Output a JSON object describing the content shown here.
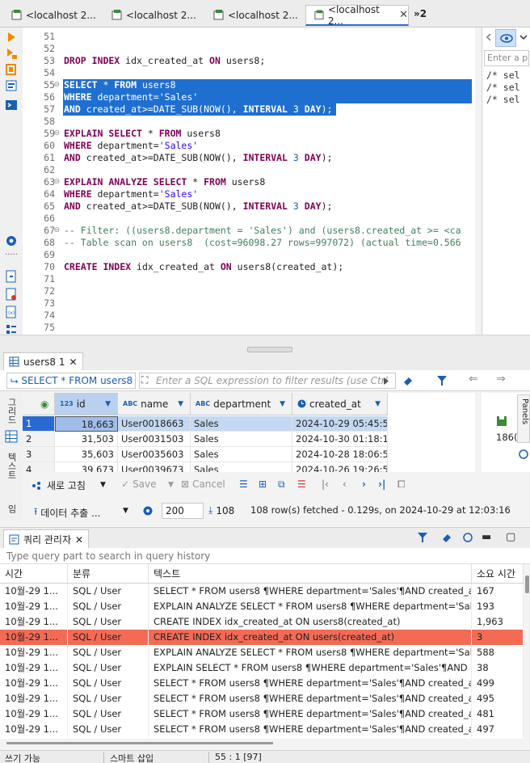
{
  "tabs": [
    {
      "label": "<localhost 2...",
      "active": false
    },
    {
      "label": "<localhost 2...",
      "active": false
    },
    {
      "label": "<localhost 2...",
      "active": false
    },
    {
      "label": "<localhost 2...",
      "active": true
    }
  ],
  "tabs_overflow": "»2",
  "editor": {
    "lines": [
      {
        "n": "51",
        "html": ""
      },
      {
        "n": "52",
        "html": ""
      },
      {
        "n": "53",
        "html": "<span class='kw'>DROP INDEX</span> idx_created_at <span class='kw'>ON</span> users8;"
      },
      {
        "n": "54",
        "html": ""
      },
      {
        "n": "55",
        "html": "<span class='kw'>SELECT</span> * <span class='kw'>FROM</span> users8",
        "sel": true,
        "fold": true
      },
      {
        "n": "56",
        "html": "<span class='kw'>WHERE</span> department=<span class='str'>'Sales'</span>",
        "sel": true
      },
      {
        "n": "57",
        "html": "<span class='kw'>AND</span> created_at&gt;=DATE_SUB(NOW(), <span class='kw'>INTERVAL</span> <span class='num'>3</span> <span class='kw'>DAY</span>);",
        "sel": true,
        "selw": 338
      },
      {
        "n": "58",
        "html": ""
      },
      {
        "n": "59",
        "html": "<span class='kw'>EXPLAIN SELECT</span> * <span class='kw'>FROM</span> users8",
        "fold": true
      },
      {
        "n": "60",
        "html": "<span class='kw'>WHERE</span> department=<span class='str'>'Sales'</span>"
      },
      {
        "n": "61",
        "html": "<span class='kw'>AND</span> created_at&gt;=DATE_SUB(NOW(), <span class='kw'>INTERVAL</span> <span class='num'>3</span> <span class='kw'>DAY</span>);"
      },
      {
        "n": "62",
        "html": ""
      },
      {
        "n": "63",
        "html": "<span class='kw'>EXPLAIN ANALYZE SELECT</span> * <span class='kw'>FROM</span> users8",
        "fold": true
      },
      {
        "n": "64",
        "html": "<span class='kw'>WHERE</span> department=<span class='str'>'Sales'</span>"
      },
      {
        "n": "65",
        "html": "<span class='kw'>AND</span> created_at&gt;=DATE_SUB(NOW(), <span class='kw'>INTERVAL</span> <span class='num'>3</span> <span class='kw'>DAY</span>);"
      },
      {
        "n": "66",
        "html": ""
      },
      {
        "n": "67",
        "html": "<span class='cmt'>-- Filter: ((users8.department = 'Sales') and (users8.created_at &gt;= &lt;ca</span>",
        "fold": true
      },
      {
        "n": "68",
        "html": "<span class='cmt'>-- Table scan on users8  (cost=96098.27 rows=997072) (actual time=0.566</span>"
      },
      {
        "n": "69",
        "html": ""
      },
      {
        "n": "70",
        "html": "<span class='kw'>CREATE INDEX</span> idx_created_at <span class='kw'>ON</span> users8(created_at);"
      },
      {
        "n": "71",
        "html": ""
      },
      {
        "n": "72",
        "html": ""
      },
      {
        "n": "73",
        "html": ""
      },
      {
        "n": "74",
        "html": ""
      },
      {
        "n": "75",
        "html": ""
      }
    ]
  },
  "outline": {
    "filter_placeholder": "Enter a pa",
    "lines": [
      "/* sel",
      "/* sel",
      "/* sel"
    ]
  },
  "results_tab": {
    "label": "users8 1"
  },
  "filter_bar": {
    "sql": "SELECT * FROM users8 W",
    "placeholder": "Enter a SQL expression to filter results (use Ctrl"
  },
  "grid_side": {
    "text_label": "텍스트",
    "grid_label": "그리드",
    "bottom_label": "임"
  },
  "grid": {
    "columns": [
      {
        "type": "123",
        "name": "id"
      },
      {
        "type": "ABC",
        "name": "name"
      },
      {
        "type": "ABC",
        "name": "department"
      },
      {
        "type": "clock",
        "name": "created_at"
      }
    ],
    "rows": [
      {
        "num": "1",
        "id": "18,663",
        "name": "User0018663",
        "department": "Sales",
        "created_at": "2024-10-29 05:45:51",
        "selected": true
      },
      {
        "num": "2",
        "id": "31,503",
        "name": "User0031503",
        "department": "Sales",
        "created_at": "2024-10-30 01:18:16"
      },
      {
        "num": "3",
        "id": "35,603",
        "name": "User0035603",
        "department": "Sales",
        "created_at": "2024-10-28 18:06:53"
      },
      {
        "num": "4",
        "id": "39,673",
        "name": "User0039673",
        "department": "Sales",
        "created_at": "2024-10-26 19:26:58"
      }
    ],
    "right_panel_label": "Panels",
    "right_value": "186("
  },
  "toolbar1": {
    "refresh": "새로 고침",
    "save": "Save",
    "cancel": "Cancel"
  },
  "toolbar2": {
    "export": "데이터 추출 ...",
    "limit": "200",
    "fetch_count": "108",
    "status": "108 row(s) fetched - 0.129s, on 2024-10-29 at 12:03:16"
  },
  "query_manager": {
    "tab_label": "쿼리 관리자",
    "search_placeholder": "Type query part to search in query history",
    "headers": {
      "time": "시간",
      "category": "분류",
      "text": "텍스트",
      "duration": "소요 시간"
    },
    "rows": [
      {
        "time": "10월-29 1...",
        "category": "SQL / User",
        "text": "SELECT * FROM users8 ¶WHERE department='Sales'¶AND created_at>...",
        "duration": "167"
      },
      {
        "time": "10월-29 1...",
        "category": "SQL / User",
        "text": "EXPLAIN ANALYZE SELECT * FROM users8 ¶WHERE department='Sale...",
        "duration": "193"
      },
      {
        "time": "10월-29 1...",
        "category": "SQL / User",
        "text": "CREATE INDEX idx_created_at ON users8(created_at)",
        "duration": "1,963"
      },
      {
        "time": "10월-29 1...",
        "category": "SQL / User",
        "text": "CREATE INDEX idx_created_at ON users(created_at)",
        "duration": "3",
        "highlight": true
      },
      {
        "time": "10월-29 1...",
        "category": "SQL / User",
        "text": "EXPLAIN ANALYZE SELECT * FROM users8 ¶WHERE department='Sale...",
        "duration": "588"
      },
      {
        "time": "10월-29 1...",
        "category": "SQL / User",
        "text": "EXPLAIN SELECT * FROM users8 ¶WHERE department='Sales'¶AND cr...",
        "duration": "38"
      },
      {
        "time": "10월-29 1...",
        "category": "SQL / User",
        "text": "SELECT * FROM users8 ¶WHERE department='Sales'¶AND created_at>...",
        "duration": "499"
      },
      {
        "time": "10월-29 1...",
        "category": "SQL / User",
        "text": "SELECT * FROM users8 ¶WHERE department='Sales'¶AND created_at>...",
        "duration": "495"
      },
      {
        "time": "10월-29 1...",
        "category": "SQL / User",
        "text": "SELECT * FROM users8 ¶WHERE department='Sales'¶AND created_at>...",
        "duration": "481"
      },
      {
        "time": "10월-29 1...",
        "category": "SQL / User",
        "text": "SELECT * FROM users8 ¶WHERE department='Sales'¶AND created_at>...",
        "duration": "497"
      }
    ]
  },
  "statusbar": {
    "mode": "쓰기 가능",
    "insert": "스마트 삽입",
    "position": "55 : 1 [97]"
  },
  "colors": {
    "selection": "#1f6fd1",
    "highlight_row": "#f36b55",
    "keyword": "#7f0055",
    "string": "#2a00ff"
  }
}
